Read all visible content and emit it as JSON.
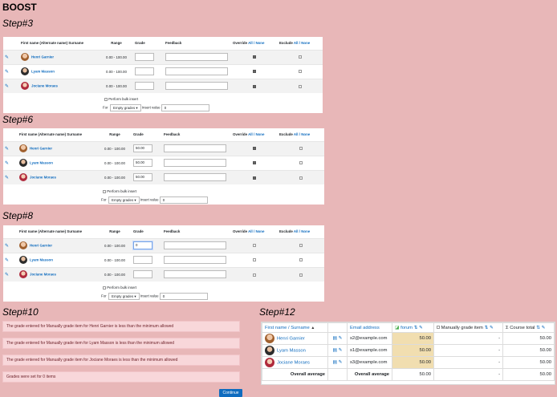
{
  "page_title": "BOOST",
  "steps": {
    "s3": "Step#3",
    "s6": "Step#6",
    "s8": "Step#8",
    "s10": "Step#10",
    "s12": "Step#12"
  },
  "bulk_table": {
    "headers": {
      "name": "First name (Alternate name) Surname",
      "range": "Range",
      "grade": "Grade",
      "feedback": "Feedback",
      "override": "Override",
      "exclude": "Exclude",
      "all": "All",
      "sep": "/",
      "none": "None"
    },
    "rows": [
      {
        "name": "Henri Garnier",
        "range": "0.00 - 100.00"
      },
      {
        "name": "Lyam Masson",
        "range": "0.00 - 100.00"
      },
      {
        "name": "Jociane Moraes",
        "range": "0.00 - 100.00"
      }
    ],
    "bulk_label": "Perform bulk insert",
    "for_label": "For",
    "select_value": "Empty grades",
    "insert_label": "Insert value",
    "insert_value": "0"
  },
  "step6_grades": [
    "50.00",
    "50.00",
    "50.00"
  ],
  "step8_grades": [
    "0",
    "",
    ""
  ],
  "alerts": [
    "The grade entered for Manually grade item for Henri Garnier is less than the minimum allowed",
    "The grade entered for Manually grade item for Lyam Masson is less than the minimum allowed",
    "The grade entered for Manually grade item for Jociane Moraes is less than the minimum allowed",
    "Grades were set for 0 items"
  ],
  "continue_label": "Continue",
  "grader": {
    "headers": {
      "name": "First name / Surname",
      "email": "Email address",
      "forum": "forum",
      "manual": "Manually grade item",
      "total": "Course total"
    },
    "rows": [
      {
        "name": "Henri Garnier",
        "email": "s2@example.com",
        "forum": "50.00",
        "manual": "-",
        "total": "50.00"
      },
      {
        "name": "Lyam Masson",
        "email": "s1@example.com",
        "forum": "50.00",
        "manual": "-",
        "total": "50.00"
      },
      {
        "name": "Jociane Moraes",
        "email": "s3@example.com",
        "forum": "50.00",
        "manual": "-",
        "total": "50.00"
      }
    ],
    "overall": {
      "label1": "Overall average",
      "label2": "Overall average",
      "forum": "50.00",
      "manual": "-",
      "total": "50.00"
    }
  },
  "colors": {
    "background": "#e8b7b8",
    "link": "#0f6cbf",
    "alert_bg": "#f8d7da",
    "highlight": "#f1deb0"
  }
}
